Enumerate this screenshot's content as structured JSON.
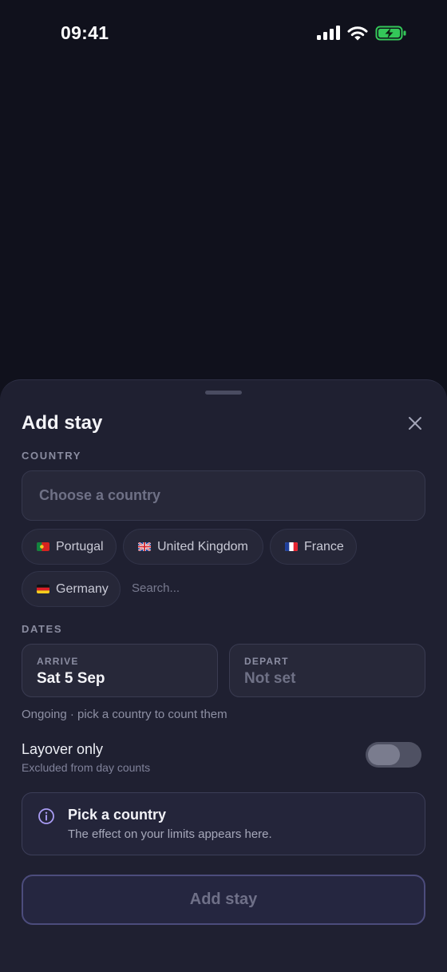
{
  "status_bar": {
    "time": "09:41"
  },
  "sheet": {
    "title": "Add stay",
    "country": {
      "section_label": "COUNTRY",
      "placeholder": "Choose a country",
      "suggestions": [
        {
          "label": "Portugal",
          "flag": "portugal-flag"
        },
        {
          "label": "United Kingdom",
          "flag": "united-kingdom-flag"
        },
        {
          "label": "France",
          "flag": "france-flag"
        },
        {
          "label": "Germany",
          "flag": "germany-flag"
        }
      ],
      "search_placeholder": "Search..."
    },
    "dates": {
      "section_label": "DATES",
      "arrive": {
        "label": "ARRIVE",
        "value": "Sat 5 Sep"
      },
      "depart": {
        "label": "DEPART",
        "value": "Not set"
      },
      "hint": "Ongoing · pick a country to count them"
    },
    "layover": {
      "title": "Layover only",
      "subtitle": "Excluded from day counts",
      "enabled": false
    },
    "info": {
      "title": "Pick a country",
      "subtitle": "The effect on your limits appears here."
    },
    "submit_label": "Add stay"
  },
  "colors": {
    "background": "#10111c",
    "sheet": "#1f2031",
    "battery_charging": "#34c759",
    "accent": "#a99cf4",
    "submit_border": "#4c4c7c"
  }
}
